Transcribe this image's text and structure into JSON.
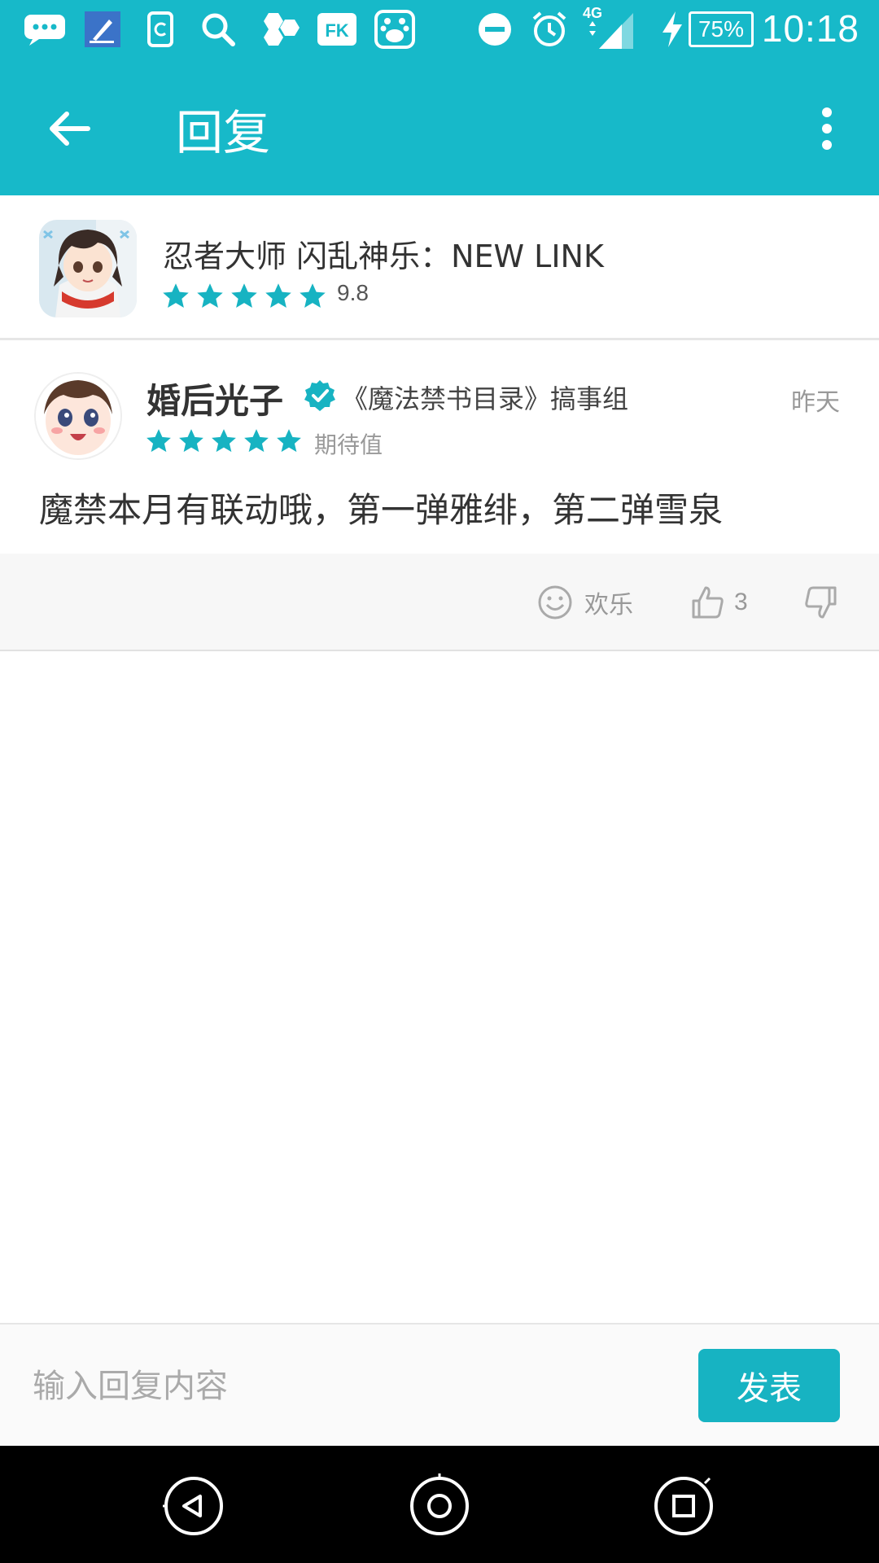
{
  "status_bar": {
    "network": "4G",
    "battery": "75%",
    "time": "10:18"
  },
  "app_bar": {
    "title": "回复"
  },
  "game": {
    "title": "忍者大师 闪乱神乐：NEW LINK",
    "score": "9.8",
    "stars": 5
  },
  "review": {
    "user_name": "婚后光子",
    "user_group": "《魔法禁书目录》搞事组",
    "time": "昨天",
    "stars": 5,
    "tag": "期待值",
    "text": "魔禁本月有联动哦，第一弹雅绯，第二弹雪泉"
  },
  "actions": {
    "happy_label": "欢乐",
    "like_count": "3"
  },
  "reply": {
    "placeholder": "输入回复内容",
    "send_label": "发表"
  },
  "colors": {
    "accent": "#17b9c9",
    "button": "#17b3c2"
  }
}
